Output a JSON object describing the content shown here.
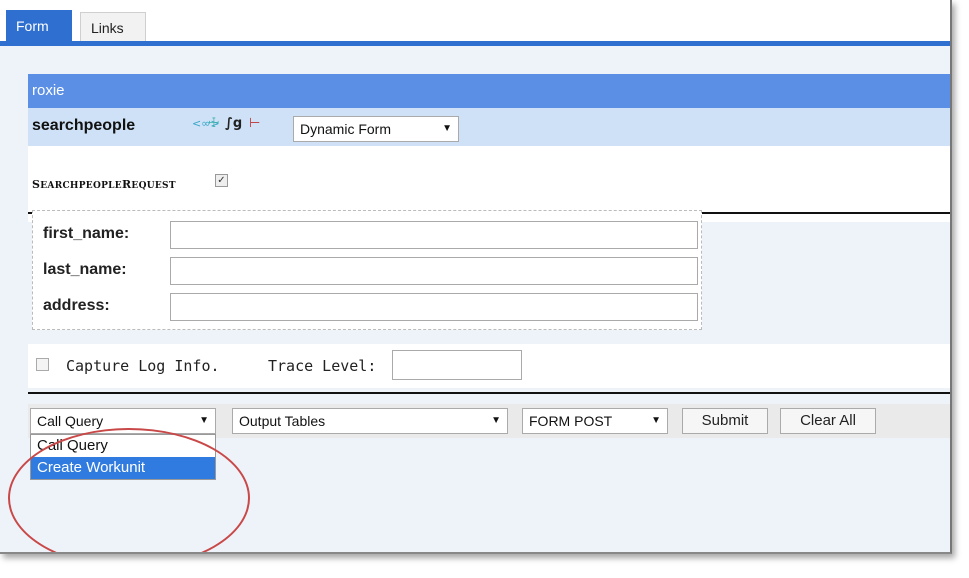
{
  "tabs": [
    {
      "label": "Form",
      "active": true
    },
    {
      "label": "Links",
      "active": false
    }
  ],
  "cluster": {
    "name": "roxie"
  },
  "query": {
    "name": "searchpeople",
    "icons": [
      "link-icon",
      "person-icon",
      "schema-icon",
      "graph-icon"
    ],
    "form_type": "Dynamic Form"
  },
  "request": {
    "label": "searchpeopleRequest",
    "checked": true,
    "fields": [
      {
        "label": "first_name:",
        "value": ""
      },
      {
        "label": "last_name:",
        "value": ""
      },
      {
        "label": "address:",
        "value": ""
      }
    ]
  },
  "options": {
    "capture_label": "Capture Log Info.",
    "capture_checked": false,
    "trace_label": "Trace Level:",
    "trace_value": ""
  },
  "actions": {
    "method": "Call Query",
    "output": "Output Tables",
    "post": "FORM POST",
    "submit": "Submit",
    "clear": "Clear All"
  },
  "method_dropdown": {
    "options": [
      "Call Query",
      "Create Workunit"
    ],
    "highlighted": "Create Workunit"
  },
  "colors": {
    "accent": "#2f6fd0",
    "cluster_header": "#5b8fe6",
    "query_header": "#cfe1f6",
    "highlight": "#2f7be0",
    "annotation_circle": "#c94848"
  }
}
